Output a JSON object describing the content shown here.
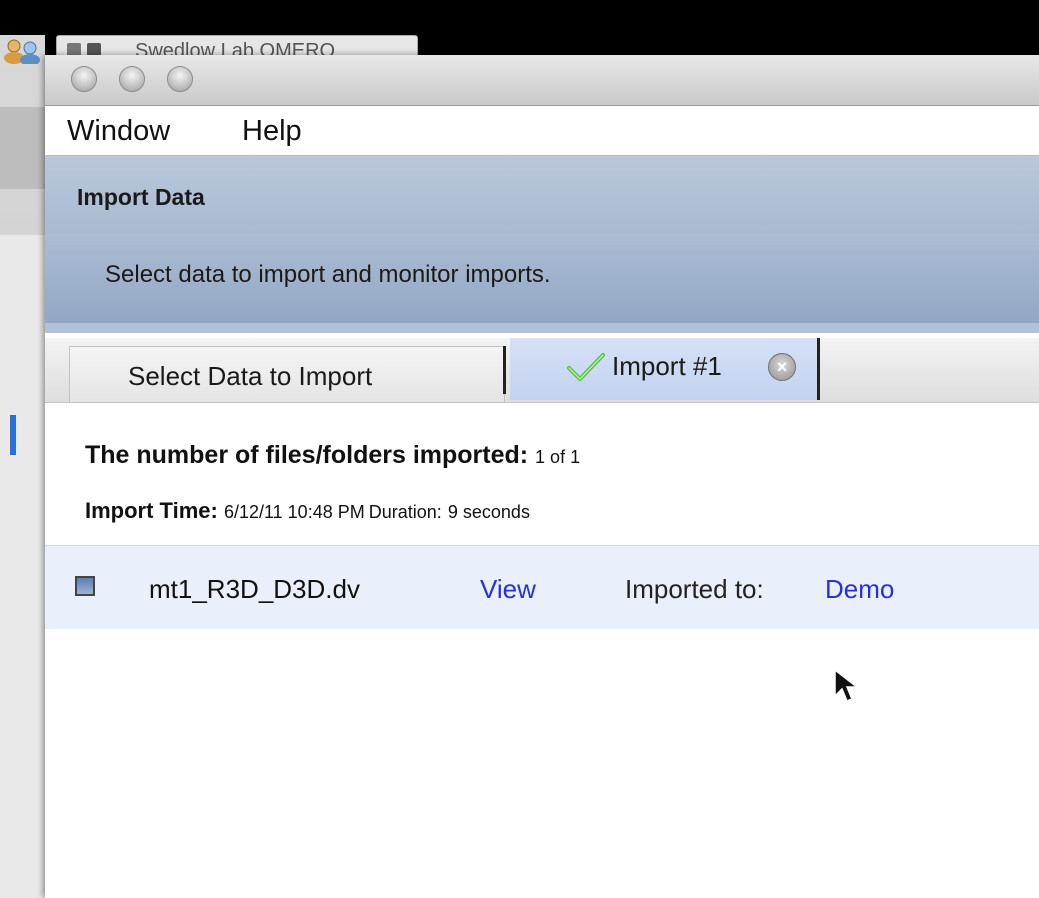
{
  "background": {
    "tab_title": "Swedlow Lab OMERO"
  },
  "menubar": {
    "items": [
      "Window",
      "Help"
    ]
  },
  "header": {
    "title": "Import Data",
    "subtitle": "Select data to import and monitor imports."
  },
  "tabs": {
    "select_label": "Select Data to Import",
    "import_label": "Import #1"
  },
  "summary": {
    "files_label": "The number of files/folders imported:",
    "files_value": "1 of 1",
    "time_label": "Import Time:",
    "time_value": "6/12/11 10:48 PM",
    "duration_label": "Duration:",
    "duration_value": "9 seconds"
  },
  "file_row": {
    "name": "mt1_R3D_D3D.dv",
    "view_link": "View",
    "imported_to_label": "Imported to:",
    "imported_to_value": "Demo"
  },
  "colors": {
    "link": "#2a2ee0",
    "header_blue": "#a9bad1",
    "active_tab": "#c2d2ef",
    "row_highlight": "#e9f0fb"
  }
}
